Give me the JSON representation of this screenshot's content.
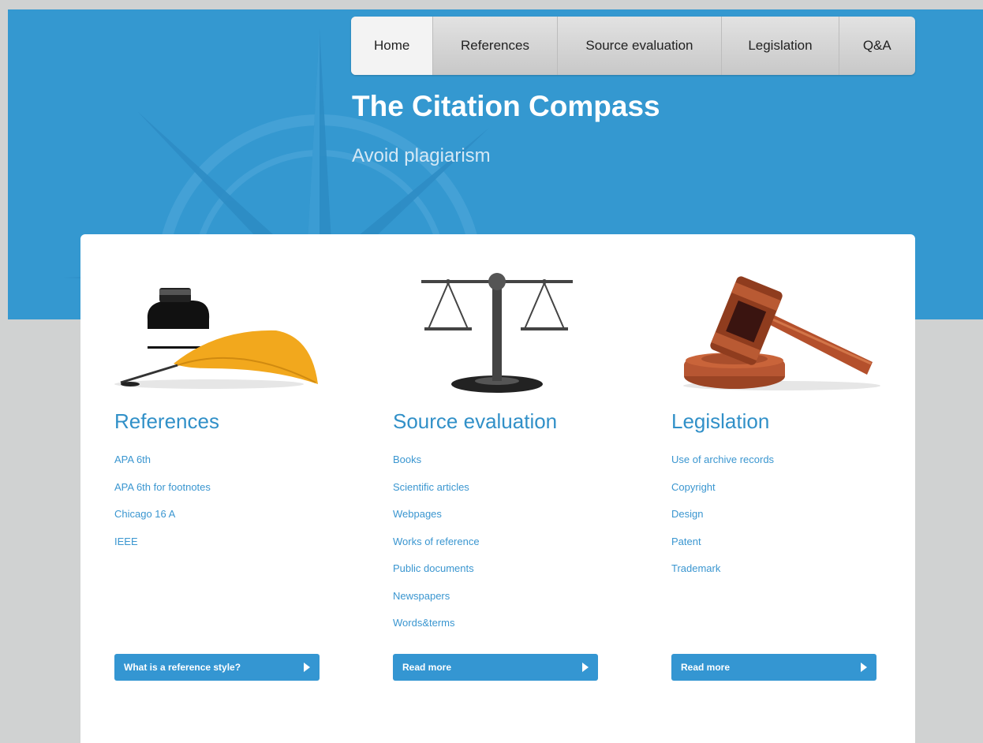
{
  "nav": {
    "items": [
      {
        "label": "Home",
        "active": true
      },
      {
        "label": "References",
        "active": false
      },
      {
        "label": "Source evaluation",
        "active": false
      },
      {
        "label": "Legislation",
        "active": false
      },
      {
        "label": "Q&A",
        "active": false
      }
    ]
  },
  "hero": {
    "title": "The Citation Compass",
    "subtitle": "Avoid plagiarism"
  },
  "columns": [
    {
      "heading": "References",
      "icon": "ink-quill-icon",
      "links": [
        "APA 6th",
        "APA 6th for footnotes",
        "Chicago 16 A",
        "IEEE"
      ],
      "button": "What is a reference style?"
    },
    {
      "heading": "Source evaluation",
      "icon": "scales-icon",
      "links": [
        "Books",
        "Scientific articles",
        "Webpages",
        "Works of reference",
        "Public documents",
        "Newspapers",
        "Words&terms"
      ],
      "button": "Read more"
    },
    {
      "heading": "Legislation",
      "icon": "gavel-icon",
      "links": [
        "Use of archive records",
        "Copyright",
        "Design",
        "Patent",
        "Trademark"
      ],
      "button": "Read more"
    }
  ],
  "colors": {
    "hero_bg": "#3498d0",
    "page_bg": "#d0d2d2",
    "accent": "#3496d2",
    "link": "#3a96d0"
  }
}
